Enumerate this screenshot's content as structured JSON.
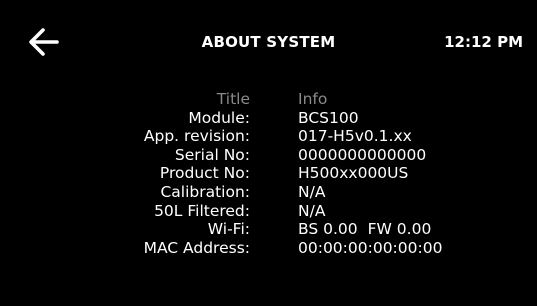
{
  "header": {
    "title": "ABOUT SYSTEM",
    "time": "12:12 PM",
    "back_icon": "arrow-left-icon"
  },
  "table": {
    "col_title": "Title",
    "col_info": "Info",
    "rows": [
      {
        "label": "Module:",
        "value": "BCS100"
      },
      {
        "label": "App. revision:",
        "value": "017-H5v0.1.xx"
      },
      {
        "label": "Serial No:",
        "value": "0000000000000"
      },
      {
        "label": "Product No:",
        "value": "H500xx000US"
      },
      {
        "label": "Calibration:",
        "value": "N/A"
      },
      {
        "label": "50L Filtered:",
        "value": "N/A"
      },
      {
        "label": "Wi-Fi:",
        "bs": "BS 0.00",
        "fw": "FW 0.00"
      },
      {
        "label": "MAC Address:",
        "value": "00:00:00:00:00:00"
      }
    ]
  },
  "colors": {
    "background": "#000000",
    "text": "#ffffff",
    "header_muted": "#8a8a8a"
  }
}
